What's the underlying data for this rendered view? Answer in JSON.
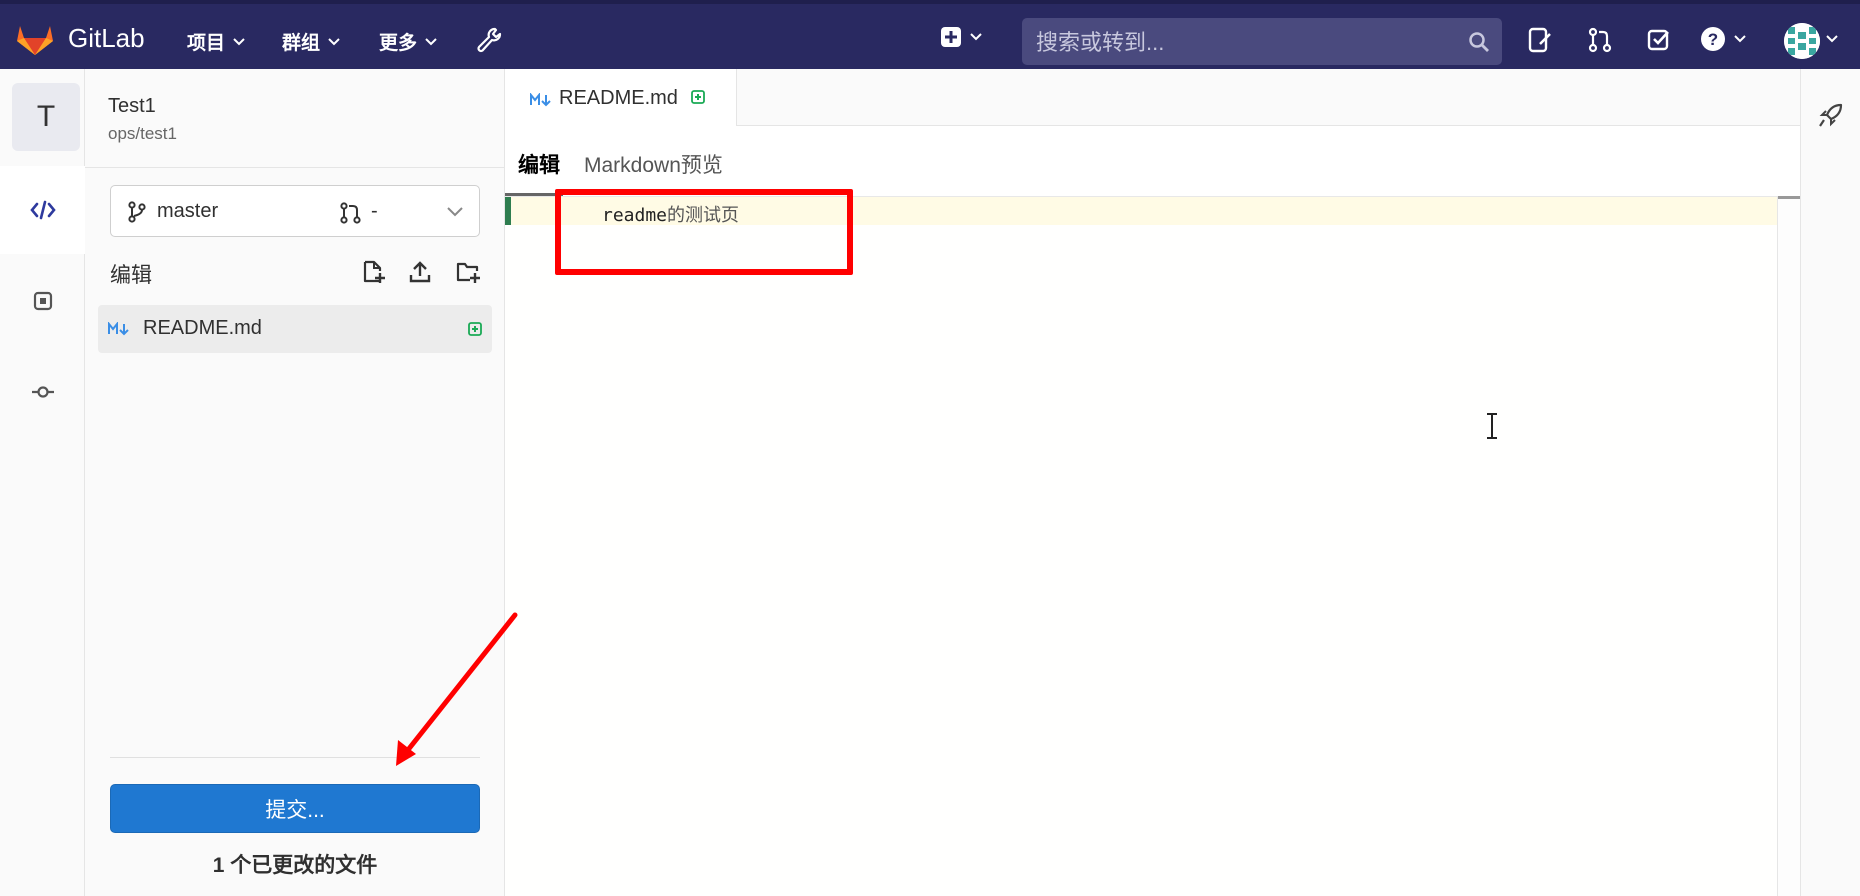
{
  "topbar": {
    "brand": "GitLab",
    "nav": [
      {
        "label": "项目"
      },
      {
        "label": "群组"
      },
      {
        "label": "更多"
      }
    ],
    "search_placeholder": "搜索或转到...",
    "icons": [
      "admin-wrench-icon",
      "create-new-icon",
      "issues-icon",
      "merge-requests-icon",
      "todos-icon",
      "help-icon"
    ]
  },
  "project": {
    "avatar_letter": "T",
    "name": "Test1",
    "path": "ops/test1"
  },
  "branch_selector": {
    "branch": "master",
    "merge_request": "-"
  },
  "file_panel": {
    "section_label": "编辑",
    "files": [
      {
        "name": "README.md",
        "status": "added"
      }
    ],
    "commit_button": "提交...",
    "changed_files_text": "1 个已更改的文件"
  },
  "editor": {
    "tab": {
      "name": "README.md"
    },
    "mode_tabs": {
      "edit": "编辑",
      "preview": "Markdown预览"
    },
    "lines": [
      {
        "ascii": "readme",
        "cjk": "的测试页"
      }
    ]
  },
  "colors": {
    "topbar": "#292961",
    "primary_button": "#1f78d1",
    "added": "#1aaa55",
    "annotation": "#ff0000"
  }
}
